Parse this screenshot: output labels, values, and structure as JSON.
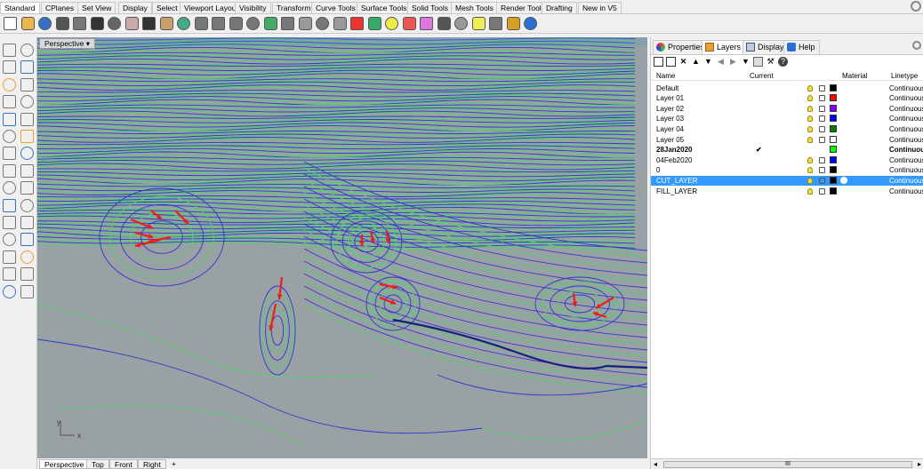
{
  "menu_tabs": [
    "Standard",
    "CPlanes",
    "Set View",
    "Display",
    "Select",
    "Viewport Layout",
    "Visibility",
    "Transform",
    "Curve Tools",
    "Surface Tools",
    "Solid Tools",
    "Mesh Tools",
    "Render Tools",
    "Drafting",
    "New in V5"
  ],
  "toolbar_icons": [
    "new-icon",
    "open-icon",
    "save-icon",
    "print-icon",
    "import-icon",
    "cut-icon",
    "copy-icon",
    "paste-icon",
    "undo-icon",
    "pan-icon",
    "rotate-view-icon",
    "zoom-icon",
    "zoom-window-icon",
    "zoom-extents-icon",
    "zoom-selected-icon",
    "undo-view-icon",
    "four-view-icon",
    "grid-snap-icon",
    "ortho-icon",
    "planar-icon",
    "osnap-icon",
    "record-history-icon",
    "light-icon",
    "shade-icon",
    "material-icon",
    "rendered-icon",
    "sphere-icon",
    "render-icon",
    "options-icon",
    "filter-icon",
    "help-icon"
  ],
  "viewport": {
    "title": "Perspective",
    "axis_x": "x",
    "axis_y": "y",
    "tabs": [
      "Perspective",
      "Top",
      "Front",
      "Right"
    ],
    "add_tab": "+"
  },
  "panel": {
    "tabs": [
      "Properties",
      "Layers",
      "Display",
      "Help"
    ],
    "columns": {
      "name": "Name",
      "current": "Current",
      "material": "Material",
      "linetype": "Linetype"
    },
    "layers": [
      {
        "name": "Default",
        "current": "",
        "color": "#000000",
        "linetype": "Continuous",
        "selected": false,
        "bold": false
      },
      {
        "name": "Layer 01",
        "current": "",
        "color": "#ff0000",
        "linetype": "Continuous",
        "selected": false,
        "bold": false
      },
      {
        "name": "Layer 02",
        "current": "",
        "color": "#8000ff",
        "linetype": "Continuous",
        "selected": false,
        "bold": false
      },
      {
        "name": "Layer 03",
        "current": "",
        "color": "#0000ff",
        "linetype": "Continuous",
        "selected": false,
        "bold": false
      },
      {
        "name": "Layer 04",
        "current": "",
        "color": "#008000",
        "linetype": "Continuous",
        "selected": false,
        "bold": false
      },
      {
        "name": "Layer 05",
        "current": "",
        "color": "#ffffff",
        "linetype": "Continuous",
        "selected": false,
        "bold": false
      },
      {
        "name": "28Jan2020",
        "current": "✔",
        "color": "#00ff00",
        "linetype": "Continuous",
        "selected": false,
        "bold": true
      },
      {
        "name": "04Feb2020",
        "current": "",
        "color": "#0000ff",
        "linetype": "Continuous",
        "selected": false,
        "bold": false
      },
      {
        "name": "0",
        "current": "",
        "color": "#000000",
        "linetype": "Continuous",
        "selected": false,
        "bold": false
      },
      {
        "name": "CUT_LAYER",
        "current": "",
        "color": "#000000",
        "linetype": "Continuous",
        "selected": true,
        "bold": false
      },
      {
        "name": "FILL_LAYER",
        "current": "",
        "color": "#000000",
        "linetype": "Continuous",
        "selected": false,
        "bold": false
      }
    ],
    "scroll_label": "III"
  }
}
